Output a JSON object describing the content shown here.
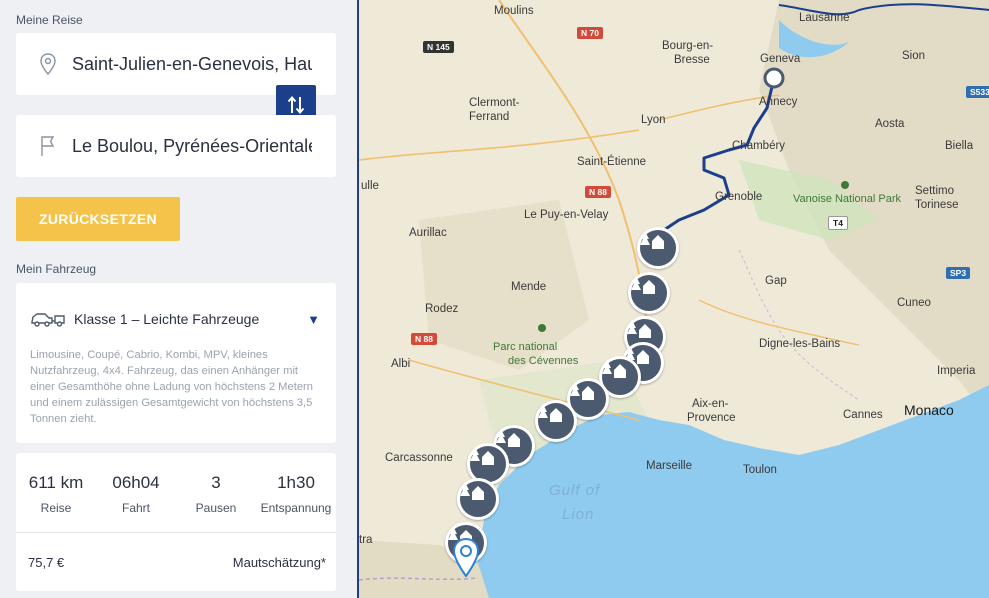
{
  "trip": {
    "section_label": "Meine Reise",
    "start": "Saint-Julien-en-Genevois, Haute-Savoie",
    "destination": "Le Boulou, Pyrénées-Orientales",
    "reset_label": "ZURÜCKSETZEN"
  },
  "vehicle": {
    "section_label": "Mein Fahrzeug",
    "class_label": "Klasse 1 – Leichte Fahrzeuge",
    "description": "Limousine, Coupé, Cabrio, Kombi, MPV, kleines Nutzfahrzeug, 4x4. Fahrzeug, das einen Anhänger mit einer Gesamthöhe ohne Ladung von höchstens 2 Metern und einem zulässigen Gesamtgewicht von höchstens 3,5 Tonnen zieht."
  },
  "stats": [
    {
      "value": "611 km",
      "label": "Reise"
    },
    {
      "value": "06h04",
      "label": "Fahrt"
    },
    {
      "value": "3",
      "label": "Pausen"
    },
    {
      "value": "1h30",
      "label": "Entspannung"
    }
  ],
  "toll": {
    "value": "75,7 €",
    "label": "Mautschätzung*"
  },
  "map": {
    "cities": {
      "moulins": "Moulins",
      "lausanne": "Lausanne",
      "bourg": "Bourg-en-",
      "bresse": "Bresse",
      "geneva": "Geneva",
      "annecy": "Annecy",
      "clermont": "Clermont-",
      "ferrand": "Ferrand",
      "lyon": "Lyon",
      "aosta": "Aosta",
      "sion": "Sion",
      "chambery": "Chambéry",
      "biella": "Biella",
      "stetienne": "Saint-Étienne",
      "grenoble": "Grenoble",
      "settimo": "Settimo",
      "torinese": "Torinese",
      "lepuy": "Le Puy-en-Velay",
      "aurillac": "Aurillac",
      "ulle": "ulle",
      "gap": "Gap",
      "mende": "Mende",
      "rodez": "Rodez",
      "cuneo": "Cuneo",
      "digne": "Digne-les-Bains",
      "albi": "Albi",
      "imperia": "Imperia",
      "aixen": "Aix-en-",
      "provence": "Provence",
      "cannes": "Cannes",
      "monaco": "Monaco",
      "carcassonne": "Carcassonne",
      "marseille": "Marseille",
      "toulon": "Toulon",
      "tra": "tra"
    },
    "park_vanoise": "Vanoise National Park",
    "park_cevennes_1": "Parc national",
    "park_cevennes_2": "des Cévennes",
    "sea_1": "Gulf of",
    "sea_2": "Lion",
    "roads": {
      "n145": "N 145",
      "n70": "N 70",
      "n88a": "N 88",
      "n88b": "N 88",
      "t4": "T4",
      "sp3": "SP3",
      "s533": "S533"
    },
    "colors": {
      "route": "#1c3f8c",
      "sea": "#8ecbef",
      "land": "#efe9d8",
      "pin": "#4b5a6e",
      "reset": "#f5c24a"
    }
  }
}
